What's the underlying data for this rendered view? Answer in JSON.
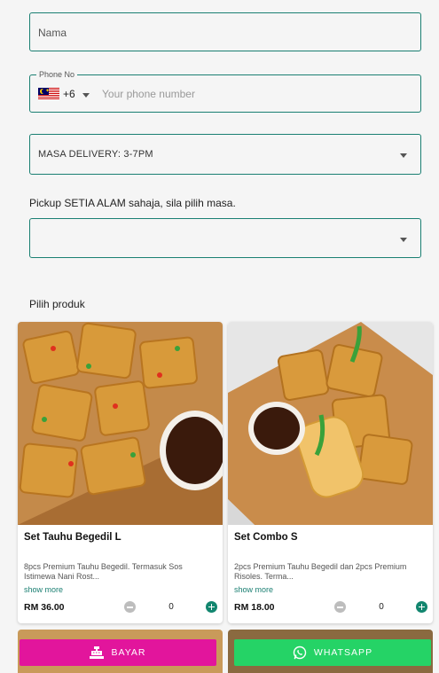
{
  "form": {
    "name_placeholder": "Nama",
    "phone_label": "Phone No",
    "phone_country_code": "+6",
    "phone_country_flag": "malaysia-flag-icon",
    "phone_placeholder": "Your phone number",
    "delivery_selected": "MASA DELIVERY: 3-7PM",
    "pickup_label": "Pickup SETIA ALAM sahaja, sila pilih masa.",
    "pickup_selected": ""
  },
  "products_section": {
    "label": "Pilih produk"
  },
  "products": [
    {
      "title": "Set Tauhu Begedil L",
      "description": "8pcs Premium Tauhu Begedil. Termasuk Sos Istimewa Nani Rost...",
      "more_label": "show more",
      "price": "RM 36.00",
      "quantity": "0"
    },
    {
      "title": "Set Combo S",
      "description": "2pcs Premium Tauhu Begedil dan 2pcs Premium Risoles. Terma...",
      "more_label": "show more",
      "price": "RM 18.00",
      "quantity": "0"
    }
  ],
  "actions": {
    "pay_label": "BAYAR",
    "pay_icon": "cash-register-icon",
    "whatsapp_label": "WHATSAPP",
    "whatsapp_icon": "whatsapp-icon"
  },
  "colors": {
    "accent": "#1a7f72",
    "pay_button": "#e2159c",
    "whatsapp_button": "#25d366",
    "plus_button": "#12866f"
  }
}
